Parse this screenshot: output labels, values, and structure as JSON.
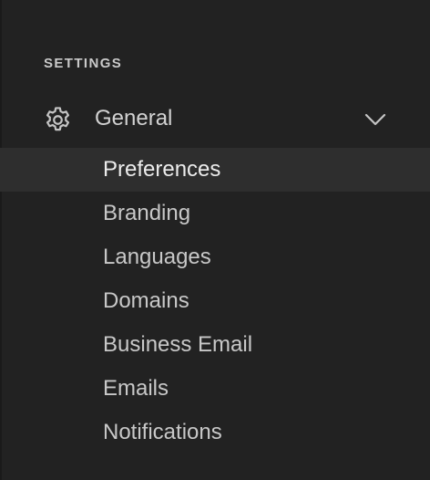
{
  "settings": {
    "section_title": "SETTINGS",
    "group": {
      "label": "General",
      "icon": "gear-icon",
      "expanded_icon": "chevron-down-icon",
      "items": [
        {
          "label": "Preferences",
          "active": true
        },
        {
          "label": "Branding",
          "active": false
        },
        {
          "label": "Languages",
          "active": false
        },
        {
          "label": "Domains",
          "active": false
        },
        {
          "label": "Business Email",
          "active": false
        },
        {
          "label": "Emails",
          "active": false
        },
        {
          "label": "Notifications",
          "active": false
        }
      ]
    }
  },
  "colors": {
    "background": "#222222",
    "active_row": "#2e2e2e",
    "text": "#c8c8c8",
    "text_active": "#ececec"
  }
}
